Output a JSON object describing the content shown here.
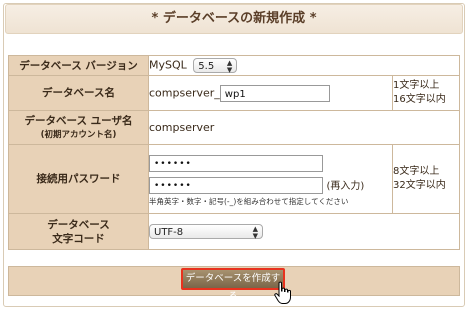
{
  "title": "* データベースの新規作成 *",
  "form": {
    "version": {
      "label": "データベース バージョン",
      "prefix": "MySQL",
      "selected": "5.5"
    },
    "dbname": {
      "label": "データベース名",
      "prefix": "compserver_",
      "value": "wp1",
      "note1": "1文字以上",
      "note2": "16文字以内"
    },
    "user": {
      "label": "データベース ユーザ名",
      "sublabel": "(初期アカウント名)",
      "value": "compserver"
    },
    "password": {
      "label": "接続用パスワード",
      "value1": "••••••",
      "value2": "••••••",
      "confirm_label": "(再入力)",
      "hint": "半角英字・数字・記号(-_)を組み合わせて指定してください",
      "note1": "8文字以上",
      "note2": "32文字以内"
    },
    "charset": {
      "label1": "データベース",
      "label2": "文字コード",
      "selected": "UTF-8"
    }
  },
  "submit_label": "データベースを作成する",
  "colors": {
    "label_bg": "#e8d2b7",
    "border": "#cdb89c",
    "highlight": "#e8321e",
    "button": "#8f7a5a"
  }
}
